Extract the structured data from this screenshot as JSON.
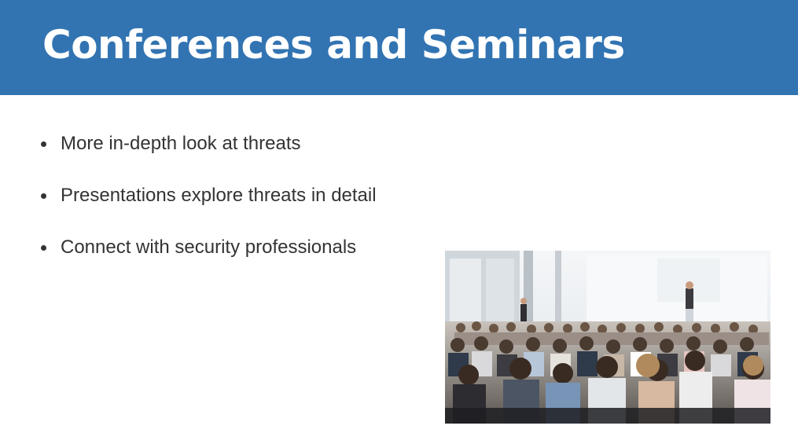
{
  "slide": {
    "title": "Conferences and Seminars",
    "bullets": [
      "More in-depth look at threats",
      "Presentations explore threats in detail",
      "Connect with security professionals"
    ],
    "photo": {
      "icon": "conference-audience-photo"
    }
  },
  "colors": {
    "header_bg": "#3274b2",
    "title_text": "#ffffff",
    "body_text": "#333333"
  }
}
